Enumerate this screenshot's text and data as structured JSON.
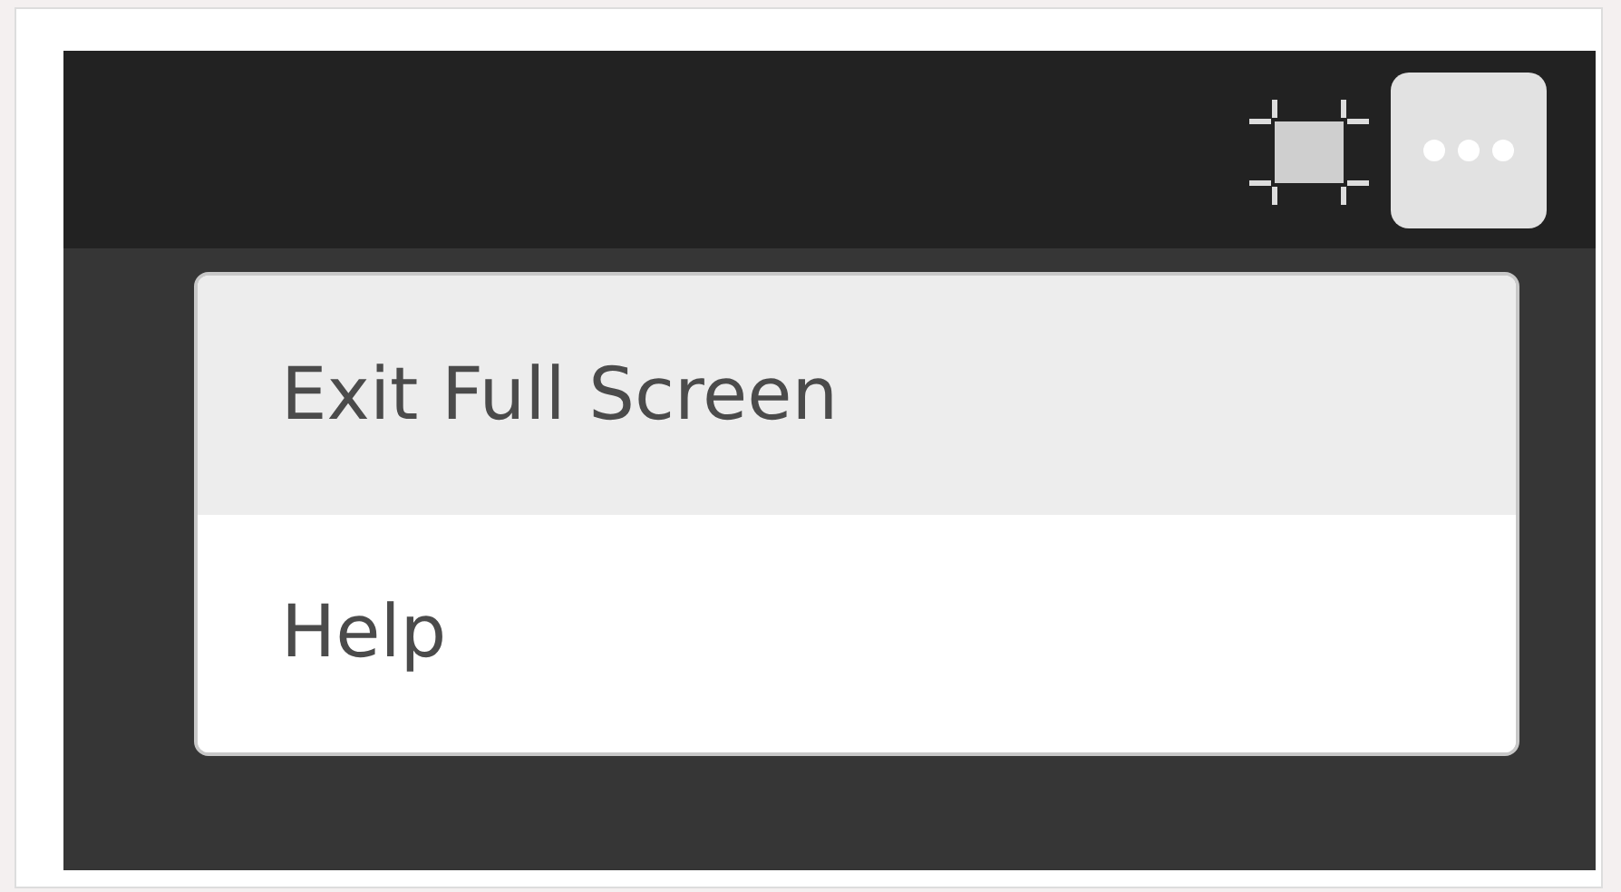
{
  "toolbar": {
    "more_button": {
      "active": true
    }
  },
  "menu": {
    "items": [
      {
        "label": "Exit Full Screen",
        "selected": true
      },
      {
        "label": "Help",
        "selected": false
      }
    ]
  }
}
